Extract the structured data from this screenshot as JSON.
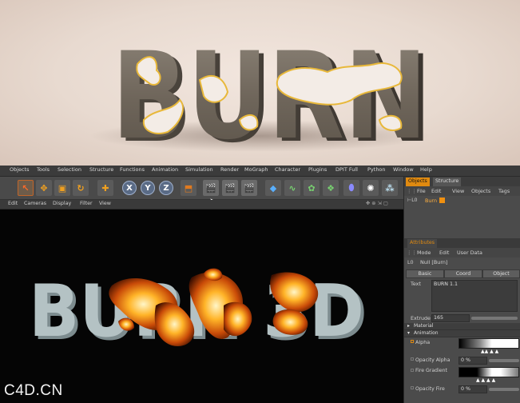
{
  "hero": {
    "title_text": "BURN"
  },
  "menubar": {
    "items": [
      "Objects",
      "Tools",
      "Selection",
      "Structure",
      "Functions",
      "Animation",
      "Simulation",
      "Render",
      "MoGraph",
      "Character",
      "Plugins",
      "DPIT Full",
      "Python",
      "Window",
      "Help"
    ]
  },
  "toolbar": {
    "axis_x": "X",
    "axis_y": "Y",
    "axis_z": "Z"
  },
  "viewport_menu": {
    "items": [
      "Edit",
      "Cameras",
      "Display",
      "Filter",
      "View"
    ]
  },
  "viewport": {
    "text": "BURN 3D"
  },
  "watermark": "C4D.CN",
  "objects_panel": {
    "tabs": [
      "Objects",
      "Structure"
    ],
    "menu": [
      "File",
      "Edit",
      "View",
      "Objects",
      "Tags"
    ],
    "tree_item": "Burn"
  },
  "attributes": {
    "tab": "Attributes",
    "menu": [
      "Mode",
      "Edit",
      "User Data"
    ],
    "object_label": "Null [Burn]",
    "buttons": [
      "Basic",
      "Coord",
      "Object"
    ],
    "text_label": "Text",
    "text_value": "BURN 1.1",
    "extrude_label": "Extrude",
    "extrude_value": "165",
    "section_material": "Material",
    "section_animation": "Animation",
    "alpha_label": "Alpha",
    "opacity_alpha_label": "Opacity Alpha",
    "opacity_alpha_value": "0 %",
    "fire_gradient_label": "Fire Gradient",
    "opacity_fire_label": "Opacity Fire",
    "opacity_fire_value": "0 %"
  },
  "colors": {
    "accent": "#e08a10",
    "panel_bg": "#4b4b4b",
    "menubar_bg": "#3b3b3b"
  }
}
